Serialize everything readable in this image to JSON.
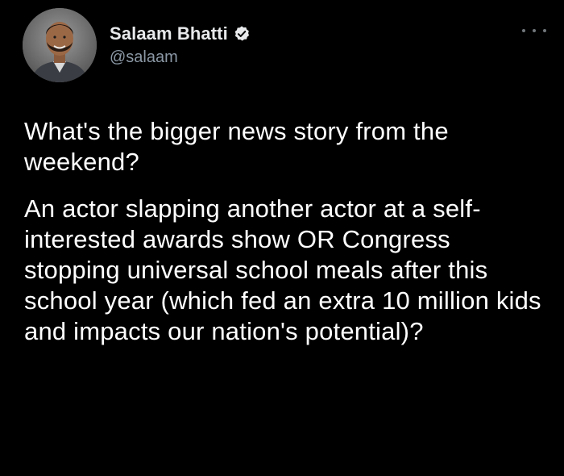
{
  "author": {
    "name": "Salaam Bhatti",
    "handle": "@salaam",
    "verified": true,
    "avatar_icon": "profile-photo"
  },
  "menu_icon": "more-options-icon",
  "tweet": {
    "paragraphs": [
      "What's the bigger news story from the weekend?",
      "An actor slapping another actor at a self-interested awards show OR Congress stopping universal school meals after this school year (which fed an extra 10 million kids and impacts our nation's potential)?"
    ]
  },
  "colors": {
    "background": "#000000",
    "text": "#ffffff",
    "secondary_text": "#8b98a5",
    "verified_badge": "#e7e9ea"
  }
}
